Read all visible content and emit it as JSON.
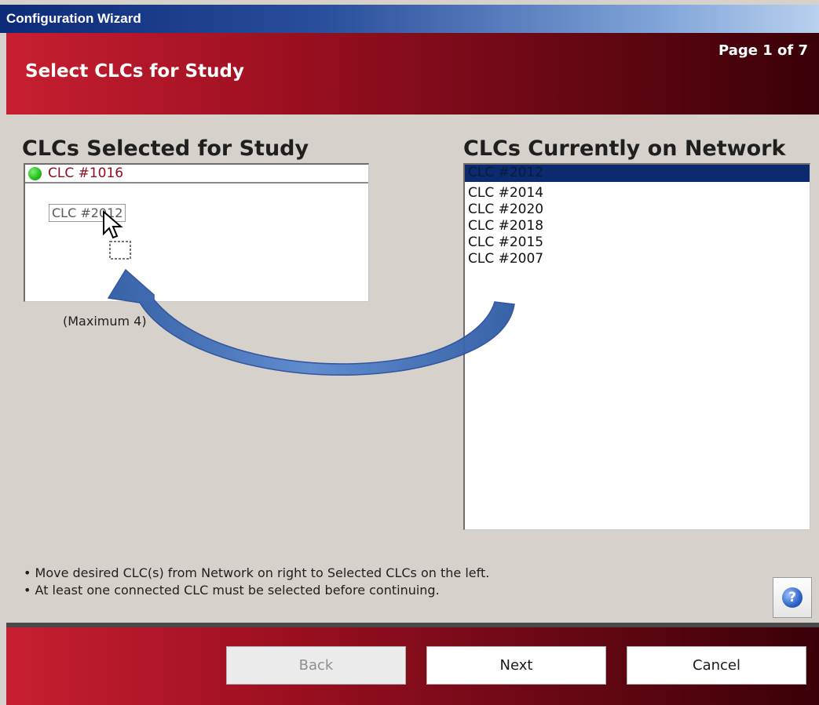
{
  "window": {
    "title": "Configuration Wizard"
  },
  "header": {
    "title": "Select CLCs for Study",
    "page_indicator": "Page 1 of 7"
  },
  "selected_panel": {
    "title": "CLCs Selected for Study",
    "items": [
      {
        "label": "CLC #1016",
        "status_color": "#26c21c"
      }
    ],
    "drag_ghost_label": "CLC #2012",
    "max_note": "(Maximum 4)"
  },
  "network_panel": {
    "title": "CLCs Currently on Network",
    "items": [
      {
        "label": "CLC #2012",
        "selected": true
      },
      {
        "label": "CLC #2014",
        "selected": false
      },
      {
        "label": "CLC #2020",
        "selected": false
      },
      {
        "label": "CLC #2018",
        "selected": false
      },
      {
        "label": "CLC #2015",
        "selected": false
      },
      {
        "label": "CLC #2007",
        "selected": false
      }
    ]
  },
  "instructions": [
    "• Move desired CLC(s) from Network on right to Selected CLCs on the left.",
    "• At least one connected CLC must be selected before continuing."
  ],
  "help": {
    "icon": "question-icon",
    "glyph": "?"
  },
  "footer": {
    "back_label": "Back",
    "next_label": "Next",
    "cancel_label": "Cancel",
    "back_enabled": false
  },
  "colors": {
    "brand_red": "#9b0f20",
    "title_blue": "#0c2a78",
    "selection_blue": "#0c2a6e",
    "arrow_blue": "#3e6fb5"
  }
}
